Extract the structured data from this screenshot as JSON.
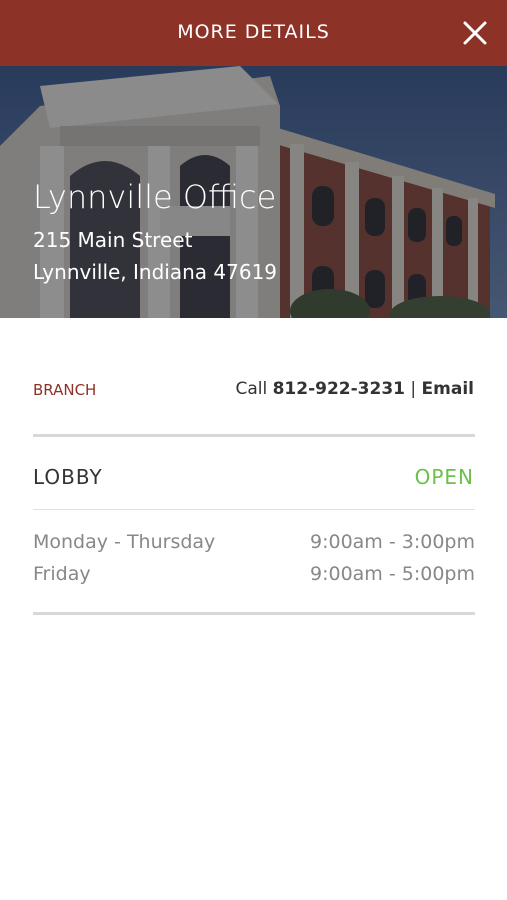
{
  "header": {
    "title": "MORE DETAILS",
    "close_icon": "close-icon",
    "background": "#8d3226"
  },
  "location": {
    "name": "Lynnville Office",
    "address_line1": "215 Main Street",
    "address_line2": "Lynnville, Indiana 47619"
  },
  "branch": {
    "label": "BRANCH",
    "call_prefix": "Call",
    "phone": "812-922-3231",
    "separator": "|",
    "email_label": "Email"
  },
  "lobby": {
    "label": "LOBBY",
    "status": "OPEN",
    "status_color": "#6cc04a",
    "hours": [
      {
        "day": "Monday - Thursday",
        "time": "9:00am - 3:00pm"
      },
      {
        "day": "Friday",
        "time": "9:00am - 5:00pm"
      }
    ]
  }
}
